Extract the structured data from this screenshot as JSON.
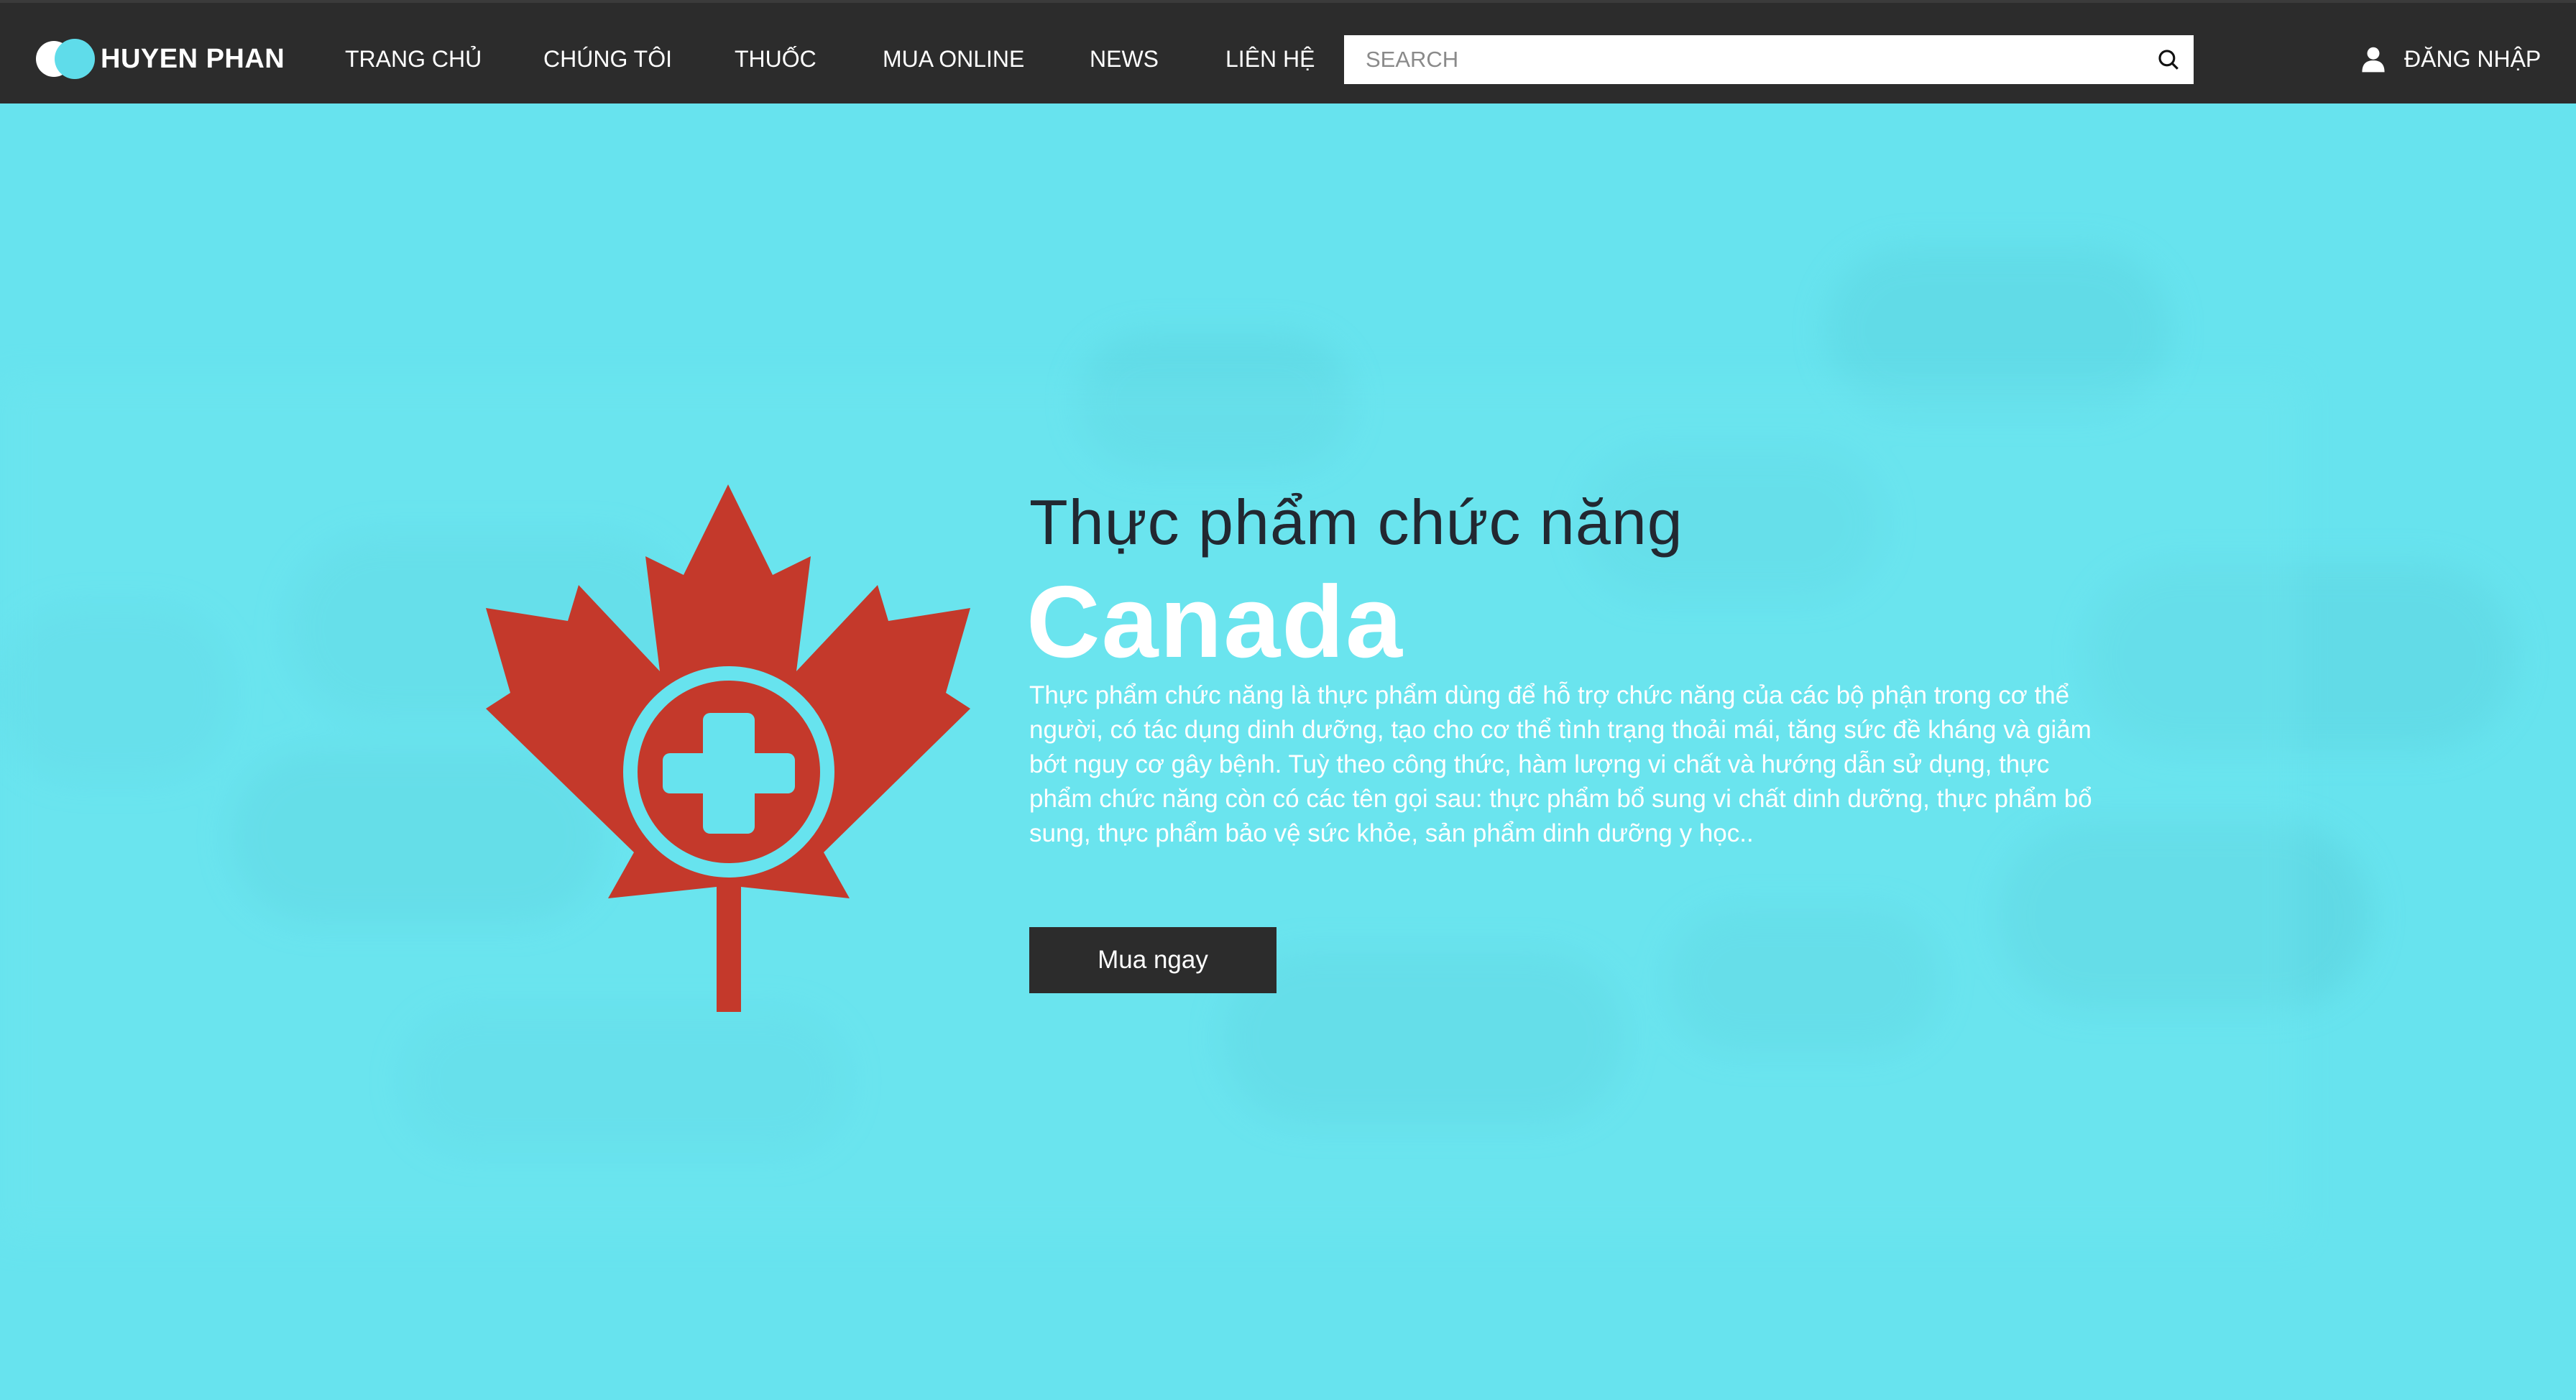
{
  "brand": {
    "name": "HUYEN PHAN"
  },
  "nav": {
    "items": [
      {
        "label": "TRANG CHỦ"
      },
      {
        "label": "CHÚNG TÔI"
      },
      {
        "label": "THUỐC"
      },
      {
        "label": "MUA ONLINE"
      },
      {
        "label": "NEWS"
      },
      {
        "label": "LIÊN HỆ"
      }
    ]
  },
  "search": {
    "placeholder": "SEARCH",
    "value": ""
  },
  "account": {
    "login_label": "ĐĂNG NHẬP"
  },
  "hero": {
    "subtitle": "Thực phẩm chức năng",
    "title": "Canada",
    "description": "Thực phẩm chức năng là thực phẩm dùng để hỗ trợ chức năng của các bộ phận trong cơ thể người, có tác dụng dinh dưỡng, tạo cho cơ thể tình trạng thoải mái, tăng sức đề kháng và giảm bớt nguy cơ gây bệnh. Tuỳ theo công thức, hàm lượng vi chất và hướng dẫn sử dụng, thực phẩm chức năng còn có các tên gọi sau: thực phẩm bổ sung vi chất dinh dưỡng, thực phẩm bổ sung, thực phẩm bảo vệ sức khỏe, sản phẩm dinh dưỡng y học..",
    "cta_label": "Mua ngay"
  },
  "colors": {
    "navbar": "#2c2c2c",
    "hero_bg": "#67e3ee",
    "leaf": "#c4392b",
    "cta_bg": "#2c2c2c"
  },
  "icons": {
    "search": "search-icon",
    "user": "user-icon",
    "leaf": "maple-leaf-cross-icon"
  }
}
